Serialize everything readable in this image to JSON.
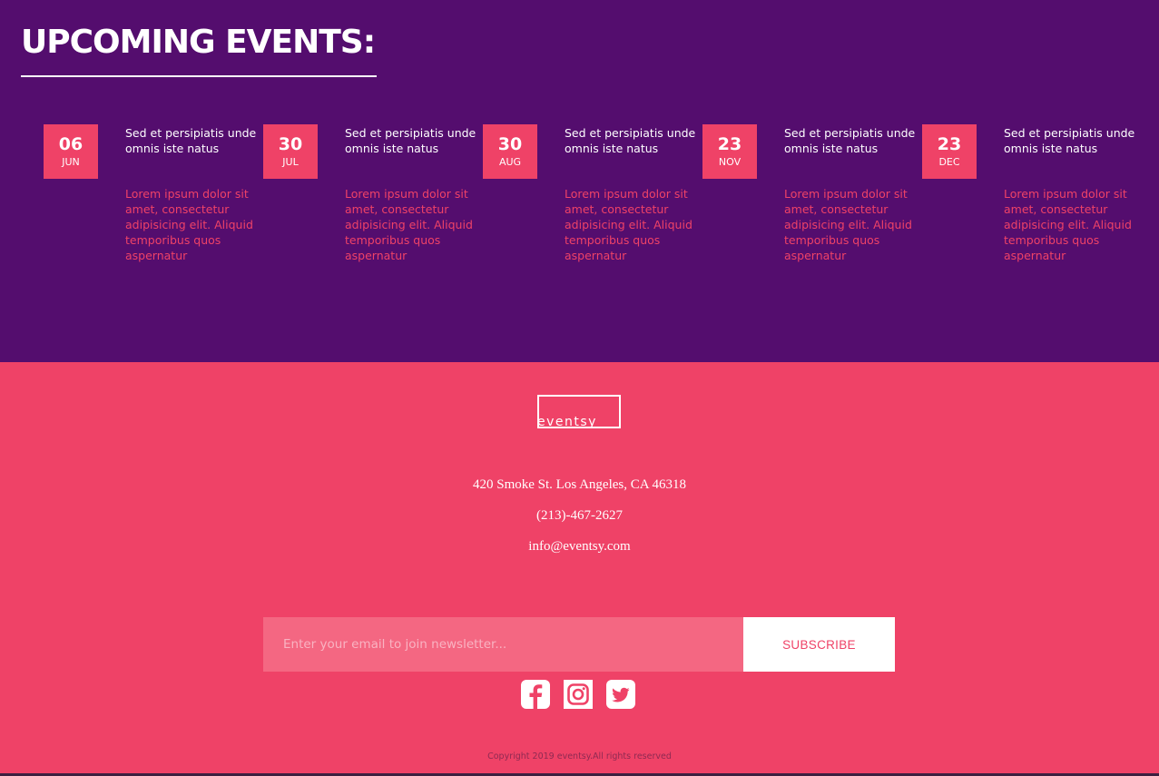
{
  "events_section": {
    "title": "UPCOMING EVENTS:",
    "events": [
      {
        "day": "06",
        "month": "JUN",
        "heading": "Sed et persipiatis unde omnis iste natus",
        "description": "Lorem ipsum dolor sit amet, consectetur adipisicing elit. Aliquid temporibus quos aspernatur"
      },
      {
        "day": "30",
        "month": "JUL",
        "heading": "Sed et persipiatis unde omnis iste natus",
        "description": "Lorem ipsum dolor sit amet, consectetur adipisicing elit. Aliquid temporibus quos aspernatur"
      },
      {
        "day": "30",
        "month": "AUG",
        "heading": "Sed et persipiatis unde omnis iste natus",
        "description": "Lorem ipsum dolor sit amet, consectetur adipisicing elit. Aliquid temporibus quos aspernatur"
      },
      {
        "day": "23",
        "month": "NOV",
        "heading": "Sed et persipiatis unde omnis iste natus",
        "description": "Lorem ipsum dolor sit amet, consectetur adipisicing elit. Aliquid temporibus quos aspernatur"
      },
      {
        "day": "23",
        "month": "DEC",
        "heading": "Sed et persipiatis unde omnis iste natus",
        "description": "Lorem ipsum dolor sit amet, consectetur adipisicing elit. Aliquid temporibus quos aspernatur"
      }
    ]
  },
  "footer": {
    "logo": "eventsy",
    "address": "420 Smoke St. Los Angeles, CA 46318",
    "phone": "(213)-467-2627",
    "email": "info@eventsy.com",
    "newsletter": {
      "placeholder": "Enter your email to join newsletter...",
      "button_label": "SUBSCRIBE"
    },
    "social_icons": [
      "facebook-icon",
      "instagram-icon",
      "twitter-icon"
    ],
    "copyright": "Copyright 2019 eventsy.All rights reserved"
  },
  "colors": {
    "purple": "#540d6e",
    "pink": "#ef4267",
    "input_pink": "#f46782",
    "white": "#ffffff"
  }
}
